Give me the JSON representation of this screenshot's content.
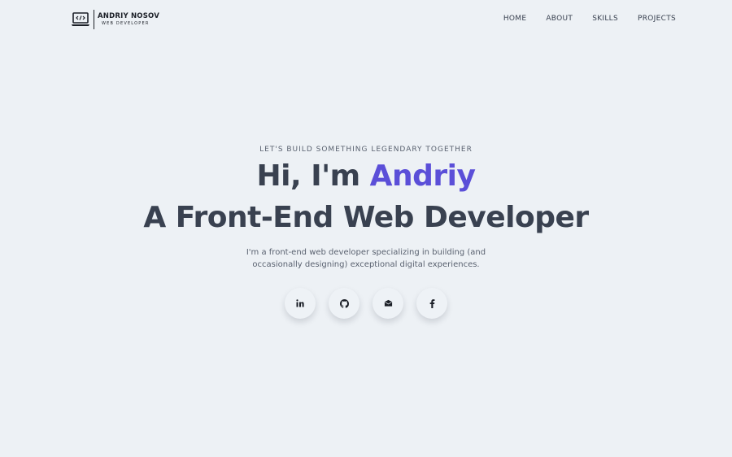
{
  "header": {
    "logo": {
      "icon": "code-laptop-icon",
      "name": "ANDRIY NOSOV",
      "subtitle": "WEB DEVELOPER"
    },
    "nav": [
      {
        "label": "HOME"
      },
      {
        "label": "ABOUT"
      },
      {
        "label": "SKILLS"
      },
      {
        "label": "PROJECTS"
      }
    ]
  },
  "hero": {
    "tagline": "LET'S BUILD SOMETHING LEGENDARY TOGETHER",
    "greeting_prefix": "Hi, I'm ",
    "greeting_name": "Andriy",
    "headline": "A Front-End Web Developer",
    "description": "I'm a front-end web developer specializing in building (and occasionally designing) exceptional digital experiences.",
    "socials": [
      {
        "icon": "linkedin-icon"
      },
      {
        "icon": "github-icon"
      },
      {
        "icon": "mail-icon"
      },
      {
        "icon": "facebook-icon"
      }
    ]
  },
  "colors": {
    "background": "#edf1f5",
    "text": "#394150",
    "accent": "#5b4fd8"
  }
}
